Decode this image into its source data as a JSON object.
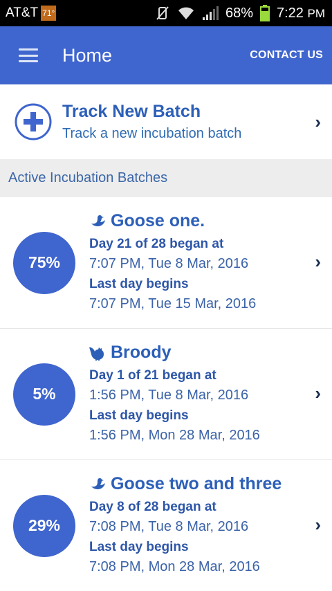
{
  "status_bar": {
    "carrier": "AT&T",
    "temperature": "71°",
    "battery_percent": "68%",
    "time": "7:22",
    "ampm": "PM"
  },
  "app_bar": {
    "title": "Home",
    "contact_label": "CONTACT US"
  },
  "track_new": {
    "title": "Track New Batch",
    "subtitle": "Track a new incubation batch"
  },
  "section_header": "Active Incubation Batches",
  "batches": [
    {
      "percent": "75%",
      "icon": "goose-icon",
      "name": "Goose one.",
      "day_label": "Day 21 of 28 began at",
      "day_value": "7:07 PM, Tue 8 Mar, 2016",
      "last_label": "Last day begins",
      "last_value": "7:07 PM, Tue 15 Mar, 2016"
    },
    {
      "percent": "5%",
      "icon": "hen-icon",
      "name": "Broody",
      "day_label": "Day 1 of 21 began at",
      "day_value": "1:56 PM, Tue 8 Mar, 2016",
      "last_label": "Last day begins",
      "last_value": "1:56 PM, Mon 28 Mar, 2016"
    },
    {
      "percent": "29%",
      "icon": "goose-icon",
      "name": "Goose two and three",
      "day_label": "Day 8 of 28 began at",
      "day_value": "7:08 PM, Tue 8 Mar, 2016",
      "last_label": "Last day begins",
      "last_value": "7:08 PM, Mon 28 Mar, 2016"
    }
  ],
  "colors": {
    "accent": "#3f65ce",
    "title_blue": "#2c5fb8",
    "section_bg": "#ededed"
  }
}
